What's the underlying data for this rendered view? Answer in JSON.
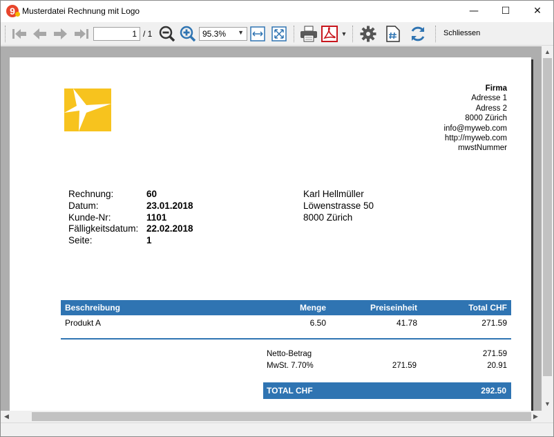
{
  "window": {
    "title": "Musterdatei Rechnung mit Logo",
    "app_icon_glyph": "9",
    "minimize_glyph": "—",
    "maximize_glyph": "☐",
    "close_glyph": "✕"
  },
  "toolbar": {
    "page_current": "1",
    "page_total": "/ 1",
    "zoom_value": "95.3%",
    "close_label": "Schliessen",
    "icons": [
      "first-page-icon",
      "previous-page-icon",
      "next-page-icon",
      "last-page-icon",
      "zoom-out-icon",
      "zoom-in-icon",
      "fit-width-icon",
      "fit-page-icon",
      "print-icon",
      "pdf-export-icon",
      "settings-icon",
      "page-number-icon",
      "refresh-icon"
    ]
  },
  "colors": {
    "accent_blue": "#2f74b2",
    "logo_yellow": "#f7c31e"
  },
  "invoice": {
    "sender": {
      "company": "Firma",
      "address1": "Adresse 1",
      "address2": "Adress 2",
      "city": "8000 Zürich",
      "email": "info@myweb.com",
      "web": "http://myweb.com",
      "vat": "mwstNummer"
    },
    "meta": [
      {
        "label": "Rechnung:",
        "value": "60"
      },
      {
        "label": "Datum:",
        "value": "23.01.2018"
      },
      {
        "label": "Kunde-Nr:",
        "value": "1101"
      },
      {
        "label": "Fälligkeitsdatum:",
        "value": "22.02.2018"
      },
      {
        "label": "Seite:",
        "value": "1"
      }
    ],
    "recipient": {
      "name": "Karl Hellmüller",
      "street": "Löwenstrasse 50",
      "city": "8000 Zürich"
    },
    "table": {
      "headers": [
        "Beschreibung",
        "Menge",
        "Preiseinheit",
        "Total CHF"
      ],
      "rows": [
        {
          "description": "Produkt A",
          "quantity": "6.50",
          "unit_price": "41.78",
          "total": "271.59"
        }
      ]
    },
    "totals": {
      "net_label": "Netto-Betrag",
      "net_value": "271.59",
      "vat_label": "MwSt. 7.70%",
      "vat_base": "271.59",
      "vat_value": "20.91",
      "grand_label": "TOTAL CHF",
      "grand_value": "292.50"
    }
  }
}
